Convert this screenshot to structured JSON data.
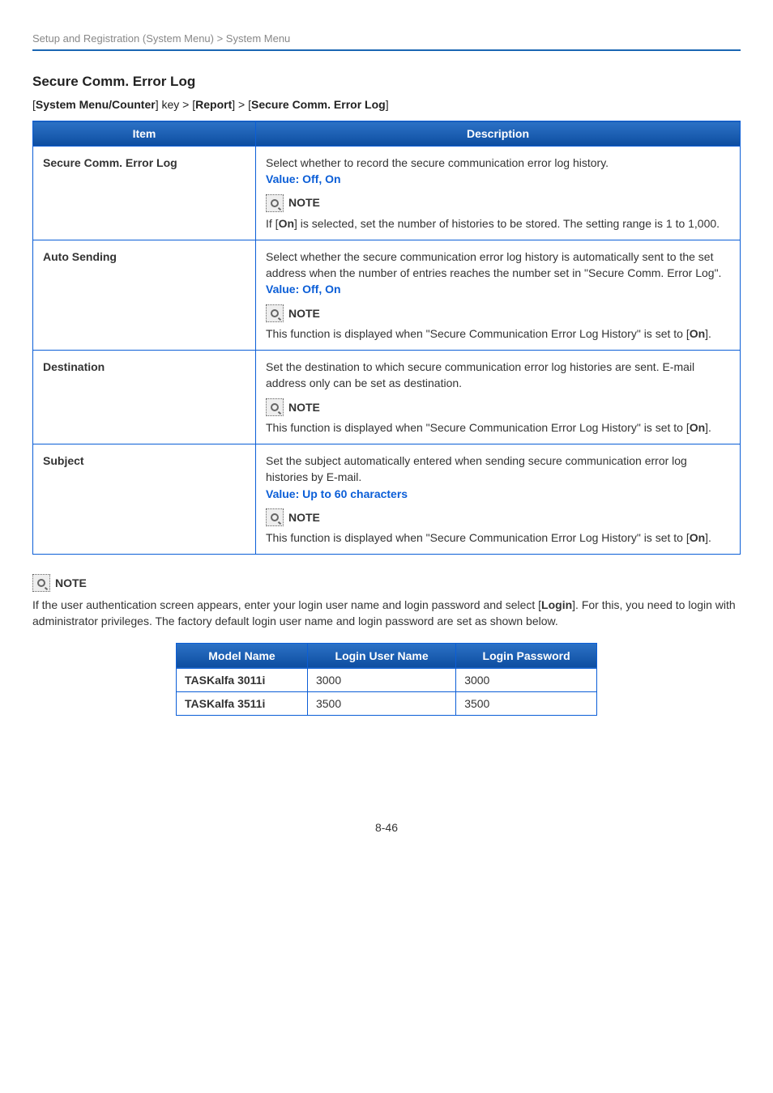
{
  "breadcrumb": "Setup and Registration (System Menu) > System Menu",
  "section_heading": "Secure Comm. Error Log",
  "path": {
    "prefix1": "[",
    "sys_menu": "System Menu/Counter",
    "sep1": "] key > [",
    "report": "Report",
    "sep2": "] > [",
    "sec_log": "Secure Comm. Error Log",
    "suffix": "]"
  },
  "table1": {
    "head_item": "Item",
    "head_desc": "Description",
    "rows": [
      {
        "item": "Secure Comm. Error Log",
        "desc_top": "Select whether to record the secure communication error log history.",
        "value": "Value: Off, On",
        "note_body_pre": "If [",
        "note_body_bold": "On",
        "note_body_post": "] is selected, set the number of histories to be stored. The setting range is 1 to 1,000."
      },
      {
        "item": "Auto Sending",
        "desc_top": "Select whether the secure communication error log history is automatically sent to the set address when the number of entries reaches the number set in \"Secure Comm. Error Log\".",
        "value": "Value: Off, On",
        "note_body": "This function is displayed when \"Secure Communication Error Log History\" is set to [",
        "note_body_bold": "On",
        "note_body_post": "]."
      },
      {
        "item": "Destination",
        "desc_top": "Set the destination to which secure communication error log histories are sent. E-mail address only can be set as destination.",
        "note_body": "This function is displayed when \"Secure Communication Error Log History\" is set to [",
        "note_body_bold": "On",
        "note_body_post": "]."
      },
      {
        "item": "Subject",
        "desc_top": "Set the subject automatically entered when sending secure communication error log histories by E-mail.",
        "value": "Value: Up to 60 characters",
        "note_body": "This function is displayed when \"Secure Communication Error Log History\" is set to [",
        "note_body_bold": "On",
        "note_body_post": "]."
      }
    ]
  },
  "note_label": "NOTE",
  "login_note": {
    "pre": "If the user authentication screen appears, enter your login user name and login password and select [",
    "bold": "Login",
    "post": "]. For this, you need to login with administrator privileges. The factory default login user name and login password are set as shown below."
  },
  "model_table": {
    "head_model": "Model Name",
    "head_user": "Login User Name",
    "head_pass": "Login Password",
    "rows": [
      {
        "model": "TASKalfa 3011i",
        "user": "3000",
        "pass": "3000"
      },
      {
        "model": "TASKalfa 3511i",
        "user": "3500",
        "pass": "3500"
      }
    ]
  },
  "page_number": "8-46"
}
